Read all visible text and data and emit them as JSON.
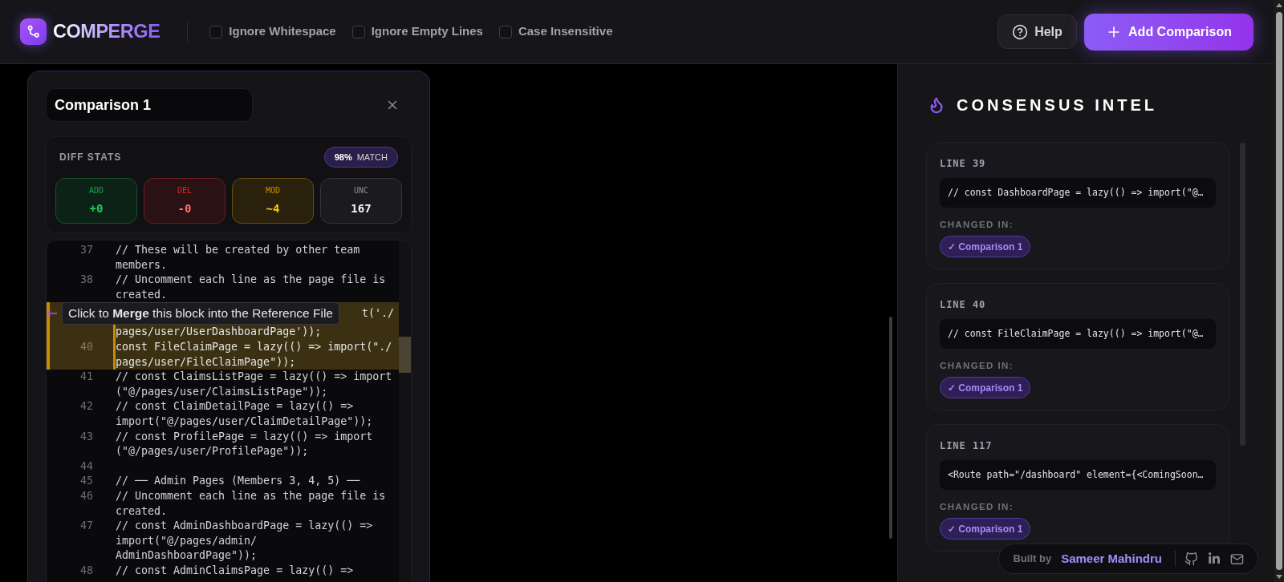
{
  "header": {
    "logo_text": "COMPERGE",
    "options": [
      {
        "label": "Ignore Whitespace",
        "checked": false
      },
      {
        "label": "Ignore Empty Lines",
        "checked": false
      },
      {
        "label": "Case Insensitive",
        "checked": false
      }
    ],
    "buttons": [
      {
        "label": "Help",
        "kind": "help"
      },
      {
        "label": "Add Comparison",
        "kind": "add"
      }
    ]
  },
  "comparison": {
    "title": "Comparison 1",
    "diff_stats": {
      "title": "DIFF STATS",
      "match": {
        "value": "98%",
        "label": "MATCH"
      },
      "tiles": [
        {
          "label": "ADD",
          "value": "+0",
          "kind": "add"
        },
        {
          "label": "DEL",
          "value": "-0",
          "kind": "del"
        },
        {
          "label": "MOD",
          "value": "~4",
          "kind": "mod"
        },
        {
          "label": "UNC",
          "value": "167",
          "kind": "unc"
        }
      ]
    },
    "code": {
      "lines": [
        {
          "number": "37",
          "rows": [
            "// These will be created by other team",
            "members."
          ],
          "changed": false
        },
        {
          "number": "38",
          "rows": [
            "// Uncomment each line as the page file is",
            "created."
          ],
          "changed": false
        },
        {
          "rows": [
            "t('./",
            "pages/user/UserDashboardPage'));"
          ],
          "changed": true,
          "tooltip": "Click to **Merge** this block into the Reference File"
        },
        {
          "number": "40",
          "rows": [
            "const FileClaimPage = lazy(() => import(\"./",
            "pages/user/FileClaimPage\"));"
          ],
          "changed": true
        },
        {
          "number": "41",
          "rows": [
            "// const ClaimsListPage = lazy(() => import",
            "(\"@/pages/user/ClaimsListPage\"));"
          ],
          "changed": false
        },
        {
          "number": "42",
          "rows": [
            "// const ClaimDetailPage = lazy(() =>",
            "import(\"@/pages/user/ClaimDetailPage\"));"
          ],
          "changed": false
        },
        {
          "number": "43",
          "rows": [
            "// const ProfilePage = lazy(() => import",
            "(\"@/pages/user/ProfilePage\"));"
          ],
          "changed": false
        },
        {
          "number": "44",
          "changed": false
        },
        {
          "number": "45",
          "rows": [
            "// ── Admin Pages (Members 3, 4, 5) ──"
          ],
          "changed": false
        },
        {
          "number": "46",
          "rows": [
            "// Uncomment each line as the page file is",
            "created."
          ],
          "changed": false
        },
        {
          "number": "47",
          "rows": [
            "// const AdminDashboardPage = lazy(() =>",
            "import(\"@/pages/admin/",
            "AdminDashboardPage\"));"
          ],
          "changed": false
        },
        {
          "number": "48",
          "rows": [
            "// const AdminClaimsPage = lazy(() =>"
          ],
          "changed": false
        }
      ]
    }
  },
  "consensus": {
    "title": "CONSENSUS INTEL",
    "changes": [
      {
        "line": "LINE 39",
        "code": "// const DashboardPage = lazy(() => import(\"@…",
        "changed_in_label": "CHANGED IN:",
        "comparisons": [
          "✓ Comparison 1"
        ]
      },
      {
        "line": "LINE 40",
        "code": "// const FileClaimPage = lazy(() => import(\"@…",
        "changed_in_label": "CHANGED IN:",
        "comparisons": [
          "✓ Comparison 1"
        ]
      },
      {
        "line": "LINE 117",
        "code": "<Route path=\"/dashboard\" element={<ComingSoon…",
        "changed_in_label": "CHANGED IN:",
        "comparisons": [
          "✓ Comparison 1"
        ]
      }
    ]
  },
  "footer": {
    "built_by": "Built by",
    "author": "Sameer Mahindru"
  }
}
